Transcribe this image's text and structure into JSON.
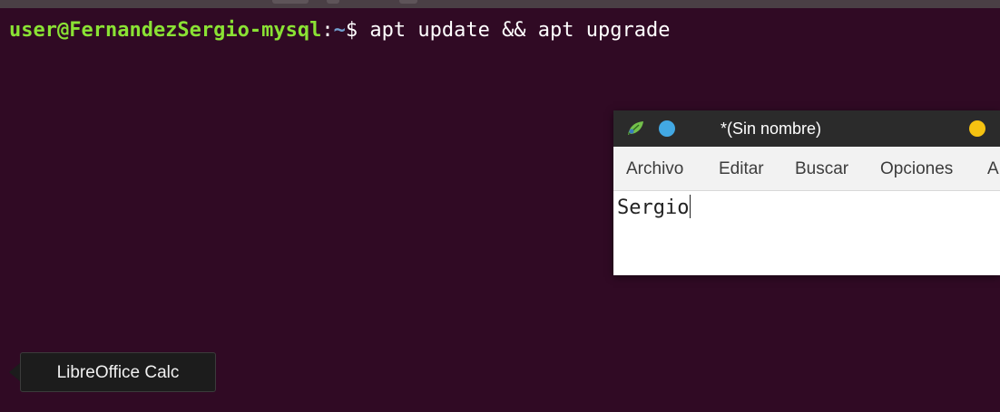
{
  "terminal": {
    "prompt_user_host": "user@FernandezSergio-mysql",
    "prompt_colon": ":",
    "prompt_path": "~",
    "prompt_symbol": "$",
    "command": " apt update && apt upgrade"
  },
  "editor": {
    "title": "*(Sin nombre)",
    "menu": [
      "Archivo",
      "Editar",
      "Buscar",
      "Opciones",
      "A"
    ],
    "content": "Sergio"
  },
  "dock_tooltip": {
    "label": "LibreOffice Calc"
  },
  "colors": {
    "terminal_bg": "#300a24",
    "prompt_user": "#8ae234",
    "prompt_path": "#729fcf",
    "editor_dot_blue": "#42a8e3",
    "editor_dot_yellow": "#f5c211"
  }
}
